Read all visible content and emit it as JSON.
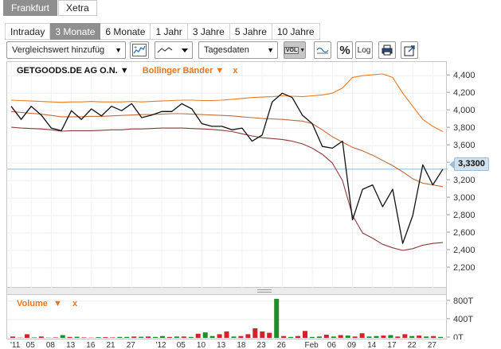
{
  "exchanges": [
    {
      "label": "Frankfurt",
      "active": true
    },
    {
      "label": "Xetra",
      "active": false
    }
  ],
  "periods": [
    {
      "label": "Intraday",
      "active": false
    },
    {
      "label": "3 Monate",
      "active": true
    },
    {
      "label": "6 Monate",
      "active": false
    },
    {
      "label": "1 Jahr",
      "active": false
    },
    {
      "label": "3 Jahre",
      "active": false
    },
    {
      "label": "5 Jahre",
      "active": false
    },
    {
      "label": "10 Jahre",
      "active": false
    }
  ],
  "toolbar": {
    "compare_label": "Vergleichswert hinzufüg",
    "interval_label": "Tagesdaten",
    "vol_label": "VOL",
    "percent_label": "%",
    "log_label": "Log"
  },
  "icons": {
    "add_indicator": "indicator-icon",
    "line_type": "line-chart-icon",
    "vol_toggle": "volume-icon",
    "trend": "trend-line-icon",
    "percent": "percent-icon",
    "log": "log-scale-icon",
    "print": "print-icon",
    "popout": "popout-icon"
  },
  "legend": {
    "security": "GETGOODS.DE AG  O.N.",
    "security_arrow": "▼",
    "indicator": "Bollinger Bänder",
    "indicator_arrow": "▼",
    "close_mark": "x"
  },
  "volume_legend": {
    "label": "Volume",
    "arrow": "▼",
    "close_mark": "x"
  },
  "current_price": "3,3300",
  "colors": {
    "price": "#111111",
    "upper_band": "#ee7a22",
    "middle_band": "#c46a3a",
    "lower_band": "#8a3a3a",
    "vol_up": "#1a8f2a",
    "vol_down": "#d1232a",
    "marker_line": "#8fb8d8"
  },
  "chart_data": {
    "type": "line",
    "y_range": [
      2000,
      4520
    ],
    "y_ticks": [
      2200,
      2400,
      2600,
      2800,
      3000,
      3200,
      3400,
      3600,
      3800,
      4000,
      4200,
      4400
    ],
    "y_tick_labels": [
      "2,200",
      "2,400",
      "2,600",
      "2,800",
      "3,000",
      "3,200",
      "",
      "3,600",
      "3,800",
      "4,000",
      "4,200",
      "4,400"
    ],
    "x_ticks": [
      {
        "i": 0,
        "label": "'11"
      },
      {
        "i": 2,
        "label": "05"
      },
      {
        "i": 4,
        "label": "08"
      },
      {
        "i": 6,
        "label": "13"
      },
      {
        "i": 8,
        "label": "16"
      },
      {
        "i": 10,
        "label": "21"
      },
      {
        "i": 12,
        "label": "27"
      },
      {
        "i": 15,
        "label": "'12"
      },
      {
        "i": 17,
        "label": "05"
      },
      {
        "i": 19,
        "label": "10"
      },
      {
        "i": 21,
        "label": "13"
      },
      {
        "i": 23,
        "label": "18"
      },
      {
        "i": 25,
        "label": "23"
      },
      {
        "i": 27,
        "label": "26"
      },
      {
        "i": 30,
        "label": "Feb"
      },
      {
        "i": 32,
        "label": "06"
      },
      {
        "i": 34,
        "label": "09"
      },
      {
        "i": 36,
        "label": "14"
      },
      {
        "i": 38,
        "label": "17"
      },
      {
        "i": 40,
        "label": "22"
      },
      {
        "i": 42,
        "label": "27"
      }
    ],
    "series": [
      {
        "key": "price",
        "values": [
          4050,
          3900,
          4050,
          3950,
          3800,
          3770,
          4000,
          3900,
          4020,
          3940,
          4050,
          4000,
          4080,
          3920,
          3950,
          3990,
          3990,
          4080,
          4020,
          3850,
          3820,
          3820,
          3780,
          3800,
          3650,
          3720,
          4100,
          4200,
          4150,
          3950,
          3850,
          3590,
          3570,
          3650,
          2750,
          3100,
          3150,
          2900,
          3100,
          2480,
          2800,
          3380,
          3150,
          3330
        ]
      },
      {
        "key": "upper_band",
        "values": [
          4120,
          4115,
          4110,
          4105,
          4100,
          4095,
          4100,
          4100,
          4105,
          4100,
          4100,
          4100,
          4105,
          4100,
          4105,
          4110,
          4115,
          4120,
          4120,
          4115,
          4115,
          4120,
          4130,
          4140,
          4150,
          4155,
          4160,
          4170,
          4165,
          4160,
          4170,
          4180,
          4200,
          4260,
          4380,
          4400,
          4410,
          4420,
          4380,
          4200,
          4050,
          3900,
          3820,
          3760
        ]
      },
      {
        "key": "middle_band",
        "values": [
          3990,
          3980,
          3970,
          3960,
          3945,
          3930,
          3930,
          3930,
          3935,
          3935,
          3940,
          3945,
          3950,
          3955,
          3955,
          3960,
          3965,
          3965,
          3960,
          3955,
          3950,
          3945,
          3940,
          3930,
          3920,
          3910,
          3905,
          3900,
          3890,
          3880,
          3850,
          3780,
          3700,
          3640,
          3580,
          3540,
          3490,
          3430,
          3370,
          3300,
          3220,
          3170,
          3150,
          3130
        ]
      },
      {
        "key": "lower_band",
        "values": [
          3810,
          3800,
          3795,
          3790,
          3780,
          3765,
          3770,
          3770,
          3770,
          3775,
          3780,
          3780,
          3790,
          3790,
          3795,
          3800,
          3800,
          3800,
          3795,
          3790,
          3785,
          3775,
          3760,
          3735,
          3710,
          3690,
          3680,
          3670,
          3650,
          3620,
          3570,
          3500,
          3400,
          3200,
          2800,
          2600,
          2540,
          2470,
          2430,
          2400,
          2420,
          2460,
          2480,
          2490
        ]
      }
    ],
    "volume": {
      "y_range": [
        0,
        900
      ],
      "y_ticks": [
        0,
        400,
        800
      ],
      "y_tick_labels": [
        "0T",
        "400T",
        "800T"
      ],
      "values": [
        30,
        5,
        80,
        10,
        30,
        5,
        10,
        60,
        20,
        25,
        10,
        5,
        15,
        15,
        10,
        20,
        20,
        30,
        25,
        30,
        20,
        40,
        20,
        30,
        30,
        20,
        90,
        120,
        40,
        80,
        140,
        30,
        40,
        80,
        210,
        140,
        110,
        850,
        40,
        20,
        40,
        150,
        20,
        30,
        70,
        30,
        60,
        50,
        30,
        100,
        30,
        40,
        50,
        60,
        30,
        80,
        40,
        50,
        30,
        40,
        20
      ],
      "colors": [
        "down",
        "down",
        "down",
        "up",
        "down",
        "up",
        "down",
        "up",
        "down",
        "up",
        "down",
        "down",
        "up",
        "down",
        "down",
        "up",
        "up",
        "down",
        "up",
        "down",
        "up",
        "up",
        "down",
        "up",
        "down",
        "up",
        "down",
        "up",
        "up",
        "down",
        "down",
        "up",
        "down",
        "down",
        "down",
        "down",
        "down",
        "up",
        "down",
        "up",
        "down",
        "down",
        "up",
        "up",
        "down",
        "up",
        "down",
        "up",
        "down",
        "down",
        "up",
        "up",
        "down",
        "up",
        "down",
        "down",
        "up",
        "down",
        "up",
        "down",
        "up"
      ]
    }
  }
}
